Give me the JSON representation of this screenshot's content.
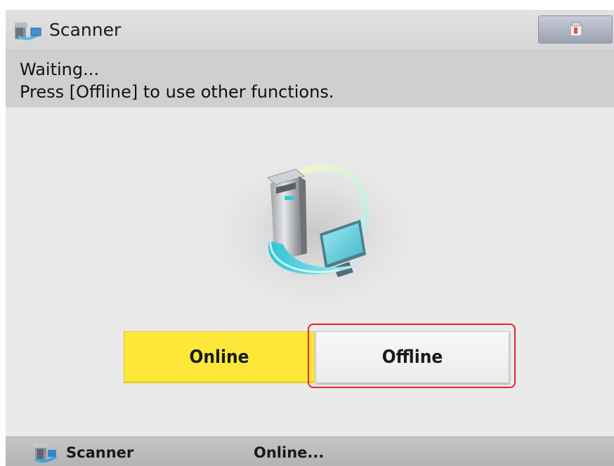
{
  "header": {
    "icon": "scanner-icon",
    "title": "Scanner",
    "status_icon": "printer-status-icon"
  },
  "message": {
    "line1": "Waiting...",
    "line2": "Press [Offline] to use other functions."
  },
  "illustration": {
    "icon": "scanner-to-computer-icon"
  },
  "buttons": {
    "online_label": "Online",
    "offline_label": "Offline",
    "online_selected": true
  },
  "status_bar": {
    "icon": "scanner-icon",
    "function": "Scanner",
    "status": "Online..."
  },
  "colors": {
    "online_active": "#fde83a",
    "highlight": "#e32626",
    "accent_cyan": "#3ec8d8"
  }
}
